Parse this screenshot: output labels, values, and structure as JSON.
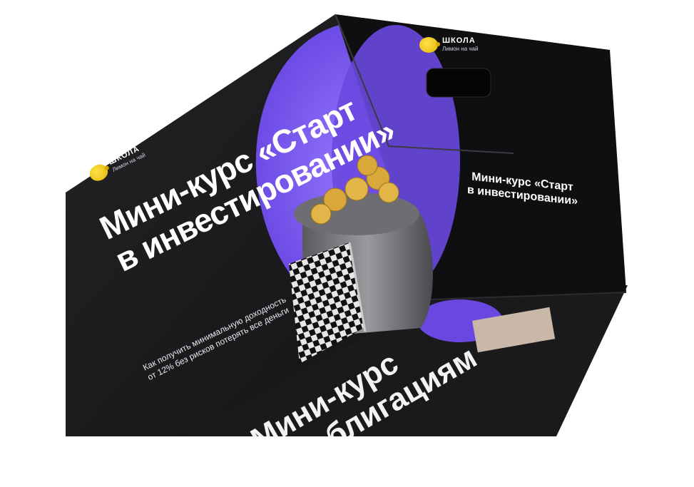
{
  "brand": {
    "name": "ШКОЛА",
    "tagline": "Лимон на чай"
  },
  "front": {
    "title_line1": "Мини-курс «Старт",
    "title_line2": "в инвестировании»",
    "subtitle_line1": "Как получить минимальную доходность",
    "subtitle_line2": "от 12% без рисков потерять все деньги"
  },
  "side": {
    "title_line1": "Мини-курс «Старт",
    "title_line2": "в инвестировании»"
  },
  "bottom": {
    "text_line1": "Мини-курс",
    "text_line2": "по облигациям"
  },
  "colors": {
    "box_dark": "#121214",
    "accent_purple": "#7d5cf0",
    "coin_gold": "#d8a93a"
  }
}
